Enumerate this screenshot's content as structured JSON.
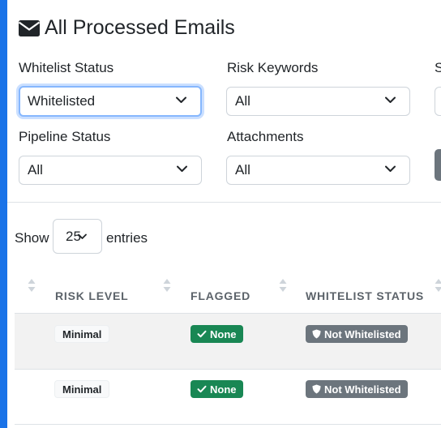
{
  "header": {
    "title": "All Processed Emails",
    "icon": "envelope-icon"
  },
  "filters": {
    "whitelist_status": {
      "label": "Whitelist Status",
      "value": "Whitelisted"
    },
    "risk_keywords": {
      "label": "Risk Keywords",
      "value": "All"
    },
    "third_label_partial": "S",
    "pipeline_status": {
      "label": "Pipeline Status",
      "value": "All"
    },
    "attachments": {
      "label": "Attachments",
      "value": "All"
    }
  },
  "entries": {
    "show_label": "Show",
    "value": "25",
    "suffix": "entries"
  },
  "table": {
    "columns": [
      "RISK LEVEL",
      "FLAGGED",
      "WHITELIST STATUS"
    ],
    "rows": [
      {
        "risk_level": "Minimal",
        "flagged": "None",
        "whitelist_status": "Not Whitelisted"
      },
      {
        "risk_level": "Minimal",
        "flagged": "None",
        "whitelist_status": "Not Whitelisted"
      }
    ]
  },
  "colors": {
    "accent": "#1a73e8",
    "success": "#198754",
    "secondary": "#6c757d",
    "focus": "#86b7fe"
  }
}
